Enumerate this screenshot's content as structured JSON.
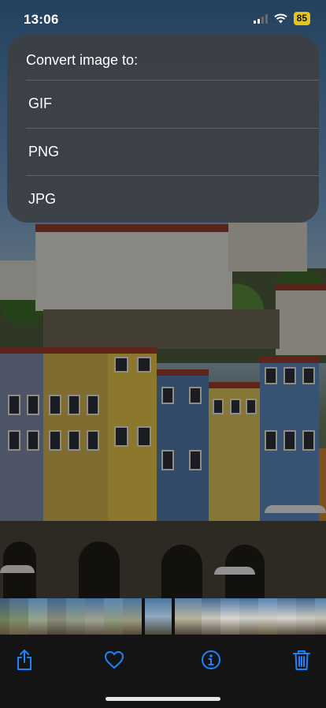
{
  "status_bar": {
    "time": "13:06",
    "battery": "85"
  },
  "menu": {
    "title": "Convert image to:",
    "options": [
      {
        "label": "GIF"
      },
      {
        "label": "PNG"
      },
      {
        "label": "JPG"
      }
    ]
  },
  "toolbar": {
    "buttons": [
      {
        "icon": "share-icon"
      },
      {
        "icon": "heart-icon"
      },
      {
        "icon": "info-icon"
      },
      {
        "icon": "trash-icon"
      }
    ]
  },
  "colors": {
    "accent": "#1a84ff",
    "battery": "#e6c41c",
    "menu_bg": "#3c4046"
  }
}
